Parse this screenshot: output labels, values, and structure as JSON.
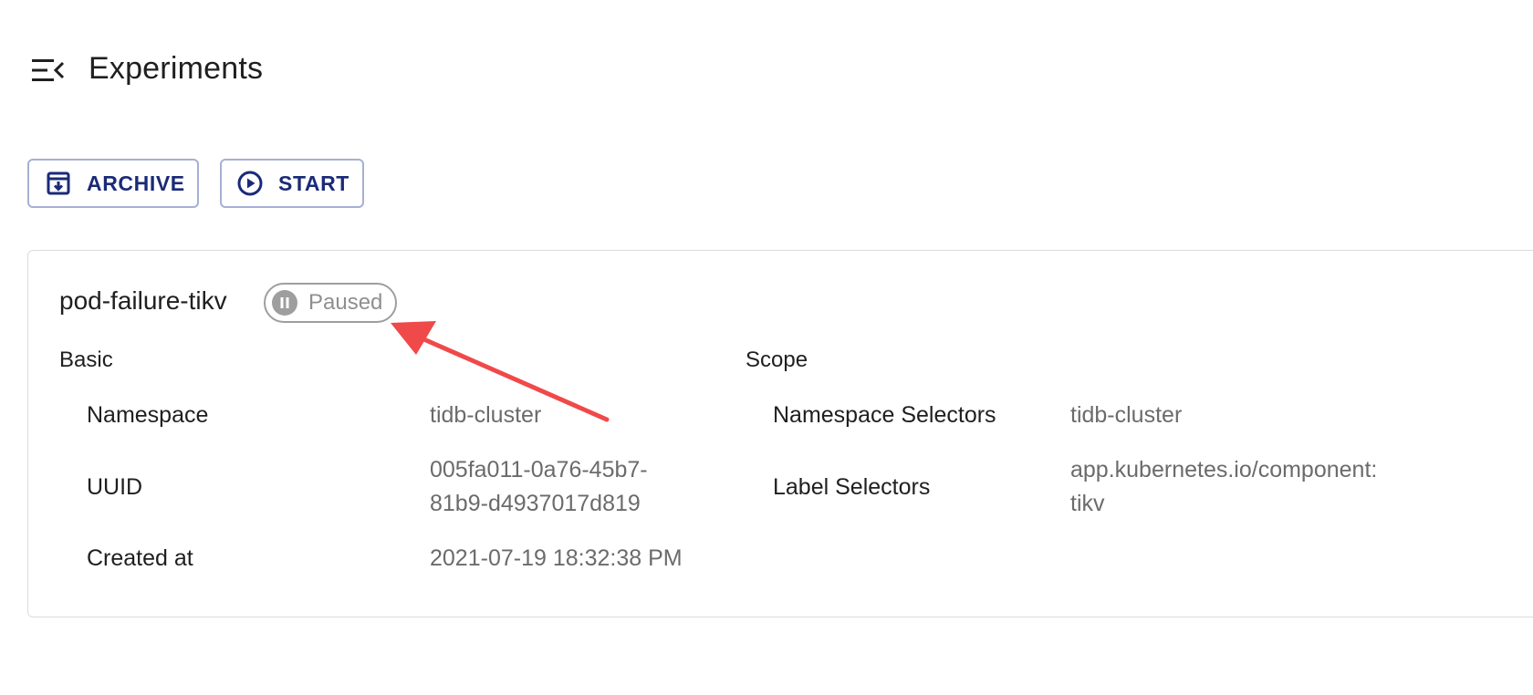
{
  "header": {
    "title": "Experiments",
    "menu_icon": "menu-collapse-icon"
  },
  "toolbar": {
    "archive_label": "ARCHIVE",
    "archive_icon": "archive-icon",
    "start_label": "START",
    "start_icon": "play-circle-icon"
  },
  "experiment": {
    "name": "pod-failure-tikv",
    "status": "Paused",
    "status_icon": "pause-circle-icon",
    "basic": {
      "title": "Basic",
      "rows": [
        {
          "label": "Namespace",
          "value": "tidb-cluster"
        },
        {
          "label": "UUID",
          "value_line1": "005fa011-0a76-45b7-",
          "value_line2": "81b9-d4937017d819"
        },
        {
          "label": "Created at",
          "value": "2021-07-19 18:32:38 PM"
        }
      ]
    },
    "scope": {
      "title": "Scope",
      "rows": [
        {
          "label": "Namespace Selectors",
          "value": "tidb-cluster"
        },
        {
          "label": "Label Selectors",
          "value_line1": "app.kubernetes.io/component:",
          "value_line2": "tikv"
        }
      ]
    }
  },
  "colors": {
    "primary": "#1b2a78",
    "button_border": "#a6b0d4",
    "status_gray": "#9e9e9e",
    "annotation_red": "#f0494a"
  }
}
